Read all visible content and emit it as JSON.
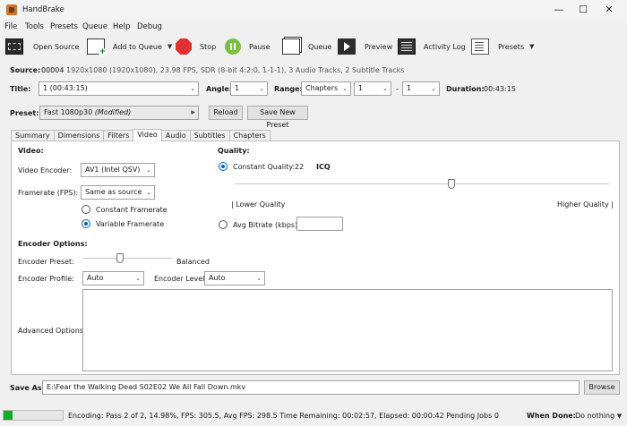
{
  "window": {
    "title": "HandBrake",
    "minimize": "—",
    "maximize": "☐",
    "close": "✕"
  },
  "menu": [
    "File",
    "Tools",
    "Presets",
    "Queue",
    "Help",
    "Debug"
  ],
  "toolbar": {
    "open_source": "Open Source",
    "add_to_queue": "Add to Queue",
    "stop": "Stop",
    "pause": "Pause",
    "queue": "Queue",
    "preview": "Preview",
    "activity_log": "Activity Log",
    "presets": "Presets"
  },
  "source": {
    "label": "Source:",
    "name": "00004",
    "info": "1920x1080 (1920x1080), 23.98 FPS, SDR (8-bit 4:2:0, 1-1-1), 3 Audio Tracks, 2 Subtitle Tracks"
  },
  "title_row": {
    "title_label": "Title:",
    "title_value": "1 (00:43:15)",
    "angle_label": "Angle:",
    "angle_value": "1",
    "range_label": "Range:",
    "range_type": "Chapters",
    "range_start": "1",
    "range_sep": "-",
    "range_end": "1",
    "duration_label": "Duration:",
    "duration_value": "00:43:15"
  },
  "preset": {
    "label": "Preset:",
    "value": "Fast 1080p30",
    "modified": "(Modified)",
    "reload": "Reload",
    "save_new": "Save New Preset"
  },
  "tabs": [
    "Summary",
    "Dimensions",
    "Filters",
    "Video",
    "Audio",
    "Subtitles",
    "Chapters"
  ],
  "active_tab": "Video",
  "video": {
    "section": "Video:",
    "encoder_label": "Video Encoder:",
    "encoder_value": "AV1 (Intel QSV)",
    "framerate_label": "Framerate (FPS):",
    "framerate_value": "Same as source",
    "constant_framerate": "Constant Framerate",
    "variable_framerate": "Variable Framerate"
  },
  "quality": {
    "section": "Quality:",
    "constant_quality": "Constant Quality:",
    "cq_value": "22",
    "cq_unit": "ICQ",
    "slider_position": 0.58,
    "lower": "| Lower Quality",
    "higher": "Higher Quality |",
    "avg_bitrate": "Avg Bitrate (kbps):",
    "bitrate_value": ""
  },
  "encoder_options": {
    "section": "Encoder Options:",
    "preset_label": "Encoder Preset:",
    "preset_position": 0.42,
    "preset_value": "Balanced",
    "profile_label": "Encoder Profile:",
    "profile_value": "Auto",
    "level_label": "Encoder Level:",
    "level_value": "Auto",
    "advanced_label": "Advanced Options:",
    "advanced_value": ""
  },
  "save_as": {
    "label": "Save As:",
    "path": "E:\\Fear the Walking Dead S02E02 We All Fall Down.mkv",
    "browse": "Browse"
  },
  "status": {
    "progress": 0.1498,
    "text": "Encoding: Pass 2 of 2,  14.98%, FPS: 305.5,  Avg FPS: 298.5  Time Remaining: 00:02:57,  Elapsed: 00:00:42   Pending Jobs 0",
    "when_done_label": "When Done:",
    "when_done_value": "Do nothing"
  }
}
